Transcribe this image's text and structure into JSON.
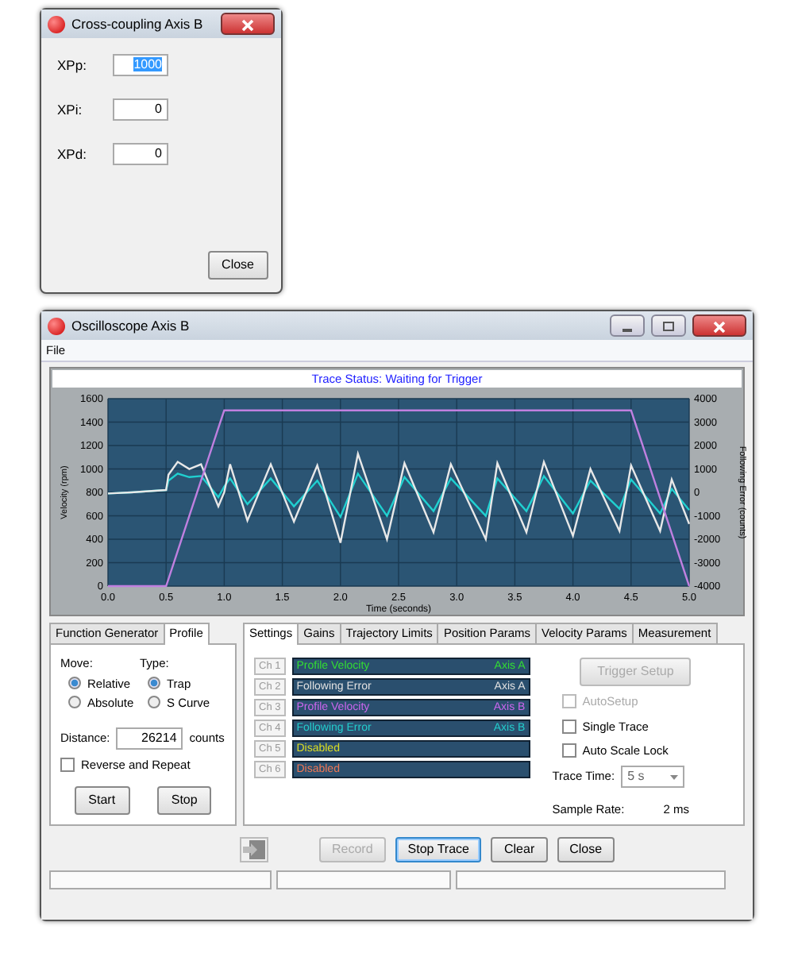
{
  "cross_coupling_dialog": {
    "title": "Cross-coupling Axis B",
    "fields": [
      {
        "label": "XPp:",
        "value": "1000",
        "selected": true
      },
      {
        "label": "XPi:",
        "value": "0",
        "selected": false
      },
      {
        "label": "XPd:",
        "value": "0",
        "selected": false
      }
    ],
    "button": "Close"
  },
  "oscilloscope_window": {
    "title": "Oscilloscope Axis B",
    "menu": [
      "File"
    ],
    "trace_status": "Trace Status:  Waiting for Trigger",
    "chart_data": {
      "type": "line",
      "xlabel": "Time (seconds)",
      "ylabel": "Velocity (rpm)",
      "y2label": "Following Error (counts)",
      "x": [
        0,
        0.2,
        0.5,
        0.52,
        0.6,
        0.7,
        0.8,
        0.95,
        1.0,
        1.05,
        1.2,
        1.4,
        1.6,
        1.8,
        2.0,
        2.15,
        2.4,
        2.55,
        2.8,
        2.95,
        3.25,
        3.35,
        3.6,
        3.75,
        4.0,
        4.15,
        4.4,
        4.5,
        4.75,
        4.85,
        5.0
      ],
      "series": [
        {
          "color": "#c080e0",
          "values": [
            0,
            0,
            0,
            60,
            300,
            600,
            900,
            1350,
            1500,
            1500,
            1500,
            1500,
            1500,
            1500,
            1500,
            1500,
            1500,
            1500,
            1500,
            1500,
            1500,
            1500,
            1500,
            1500,
            1500,
            1500,
            1500,
            1500,
            750,
            450,
            0
          ]
        },
        {
          "color": "#e8e8e8",
          "values": [
            790,
            800,
            820,
            950,
            1060,
            1000,
            1040,
            680,
            800,
            1040,
            560,
            1040,
            550,
            1030,
            370,
            1130,
            400,
            1050,
            460,
            1040,
            400,
            1050,
            460,
            1060,
            430,
            1000,
            470,
            1030,
            470,
            910,
            530
          ]
        },
        {
          "color": "#20d0d0",
          "values": [
            790,
            800,
            820,
            900,
            960,
            930,
            940,
            760,
            850,
            920,
            700,
            920,
            680,
            900,
            590,
            960,
            600,
            930,
            640,
            920,
            600,
            920,
            640,
            940,
            620,
            900,
            660,
            910,
            620,
            830,
            650
          ]
        }
      ],
      "grid": true,
      "xlim": [
        0,
        5
      ],
      "ylim": [
        0,
        1600
      ],
      "xticks": [
        {
          "value": 0,
          "label": "0.0"
        },
        {
          "value": 0.5,
          "label": "0.5"
        },
        {
          "value": 1,
          "label": "1.0"
        },
        {
          "value": 1.5,
          "label": "1.5"
        },
        {
          "value": 2,
          "label": "2.0"
        },
        {
          "value": 2.5,
          "label": "2.5"
        },
        {
          "value": 3,
          "label": "3.0"
        },
        {
          "value": 3.5,
          "label": "3.5"
        },
        {
          "value": 4,
          "label": "4.0"
        },
        {
          "value": 4.5,
          "label": "4.5"
        },
        {
          "value": 5,
          "label": "5.0"
        }
      ],
      "yticks": [
        0,
        200,
        400,
        600,
        800,
        1000,
        1200,
        1400,
        1600
      ],
      "y2lim": [
        -4000,
        4000
      ],
      "y2ticks": [
        -4000,
        -3000,
        -2000,
        -1000,
        0,
        1000,
        2000,
        3000,
        4000
      ]
    },
    "left_tabs": [
      {
        "label": "Function Generator",
        "selected": false
      },
      {
        "label": "Profile",
        "selected": true
      }
    ],
    "profile": {
      "move_label": "Move:",
      "move_options": [
        {
          "label": "Relative",
          "selected": true
        },
        {
          "label": "Absolute",
          "selected": false
        }
      ],
      "type_label": "Type:",
      "type_options": [
        {
          "label": "Trap",
          "selected": true
        },
        {
          "label": "S Curve",
          "selected": false
        }
      ],
      "distance_label": "Distance:",
      "distance_value": "26214",
      "distance_unit": "counts",
      "reverse_repeat": {
        "label": "Reverse and Repeat",
        "checked": false
      },
      "buttons": [
        "Start",
        "Stop"
      ]
    },
    "right_tabs": [
      {
        "label": "Settings",
        "selected": true
      },
      {
        "label": "Gains",
        "selected": false
      },
      {
        "label": "Trajectory Limits",
        "selected": false
      },
      {
        "label": "Position Params",
        "selected": false
      },
      {
        "label": "Velocity Params",
        "selected": false
      },
      {
        "label": "Measurement",
        "selected": false
      }
    ],
    "channels": [
      {
        "chip": "Ch 1",
        "signal": "Profile Velocity",
        "axis": "Axis A",
        "color": "#33dd33"
      },
      {
        "chip": "Ch 2",
        "signal": "Following Error",
        "axis": "Axis A",
        "color": "#e0e0e0"
      },
      {
        "chip": "Ch 3",
        "signal": "Profile Velocity",
        "axis": "Axis B",
        "color": "#cc66ee"
      },
      {
        "chip": "Ch 4",
        "signal": "Following Error",
        "axis": "Axis B",
        "color": "#22cccc"
      },
      {
        "chip": "Ch 5",
        "signal": "Disabled",
        "color": "#dddd22"
      },
      {
        "chip": "Ch 6",
        "signal": "Disabled",
        "color": "#ee7755"
      }
    ],
    "trigger_setup": {
      "label": "Trigger Setup",
      "disabled": true
    },
    "options": [
      {
        "label": "AutoSetup",
        "checked": false,
        "disabled": true
      },
      {
        "label": "Single Trace",
        "checked": false,
        "disabled": false
      },
      {
        "label": "Auto Scale Lock",
        "checked": false,
        "disabled": false
      }
    ],
    "trace_time_label": "Trace Time:",
    "trace_time_value": "5 s",
    "sample_rate_label": "Sample Rate:",
    "sample_rate_value": "2 ms",
    "bottom_buttons": [
      {
        "label": "Record",
        "disabled": true,
        "default": false
      },
      {
        "label": "Stop Trace",
        "disabled": false,
        "default": true
      },
      {
        "label": "Clear",
        "disabled": false,
        "default": false
      },
      {
        "label": "Close",
        "disabled": false,
        "default": false
      }
    ]
  }
}
